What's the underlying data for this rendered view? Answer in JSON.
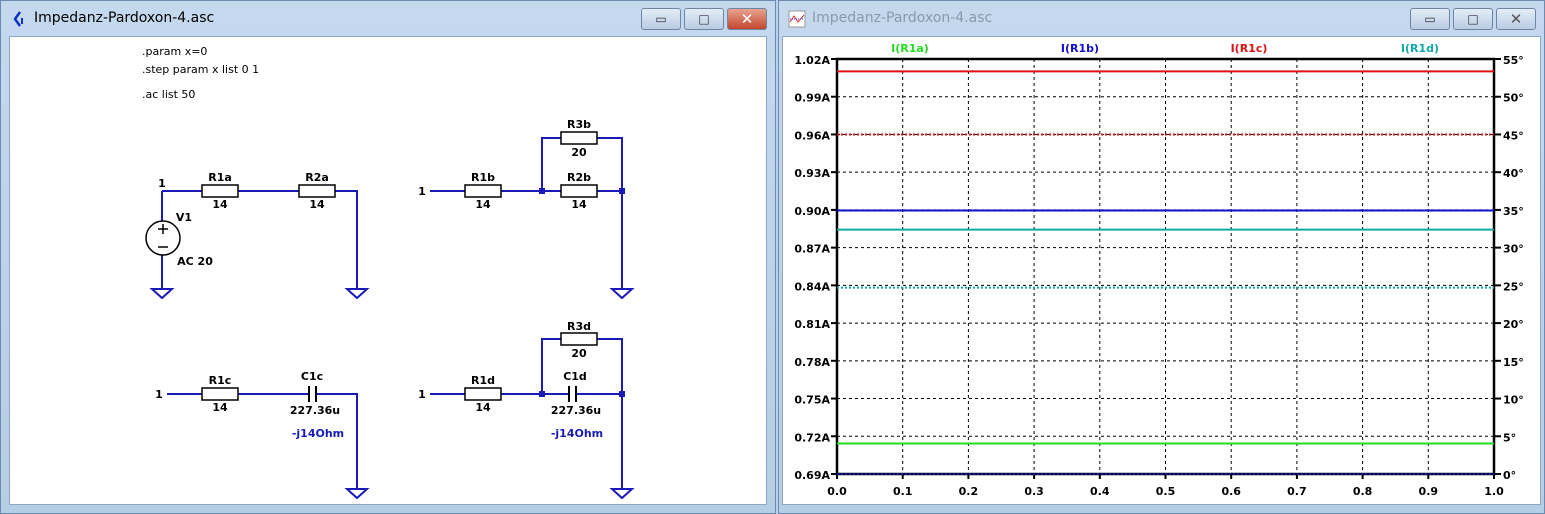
{
  "schematic_window": {
    "title": "Impedanz-Pardoxon-4.asc",
    "directives": [
      ".param x=0",
      ".step param x list 0 1",
      ".ac list 50"
    ],
    "circuit_a": {
      "node": "1",
      "r1": "R1a",
      "r1_val": "14",
      "r2": "R2a",
      "r2_val": "14",
      "source": "V1",
      "source_val": "AC 20"
    },
    "circuit_b": {
      "node": "1",
      "r1": "R1b",
      "r1_val": "14",
      "r3": "R3b",
      "r3_val": "20",
      "r2": "R2b",
      "r2_val": "14"
    },
    "circuit_c": {
      "node": "1",
      "r1": "R1c",
      "r1_val": "14",
      "c": "C1c",
      "c_val": "227.36u",
      "note": "-j14Ohm"
    },
    "circuit_d": {
      "node": "1",
      "r1": "R1d",
      "r1_val": "14",
      "r3": "R3d",
      "r3_val": "20",
      "c": "C1d",
      "c_val": "227.36u",
      "note": "-j14Ohm"
    }
  },
  "plot_window": {
    "title": "Impedanz-Pardoxon-4.asc"
  },
  "window_buttons": {
    "minimize": "▭",
    "maximize": "□",
    "close": "✕"
  },
  "chart_data": {
    "type": "line",
    "xlabel": "",
    "x": [
      0,
      1
    ],
    "xlim": [
      0,
      1
    ],
    "xticks": [
      "0.0",
      "0.1",
      "0.2",
      "0.3",
      "0.4",
      "0.5",
      "0.6",
      "0.7",
      "0.8",
      "0.9",
      "1.0"
    ],
    "ylim_left": [
      0.69,
      1.02
    ],
    "yticks_left": [
      "1.02A",
      "0.99A",
      "0.96A",
      "0.93A",
      "0.90A",
      "0.87A",
      "0.84A",
      "0.81A",
      "0.78A",
      "0.75A",
      "0.72A",
      "0.69A"
    ],
    "ylim_right": [
      0,
      55
    ],
    "yticks_right": [
      "55°",
      "50°",
      "45°",
      "40°",
      "35°",
      "30°",
      "25°",
      "20°",
      "15°",
      "10°",
      "5°",
      "0°"
    ],
    "grid": true,
    "series": [
      {
        "name": "I(R1a)",
        "color": "#22dd22",
        "magnitude": 0.7143,
        "phase": 0
      },
      {
        "name": "I(R1b)",
        "color": "#1010cc",
        "magnitude": 0.8995,
        "phase": 0
      },
      {
        "name": "I(R1c)",
        "color": "#dd1111",
        "magnitude": 1.0102,
        "phase": 45
      },
      {
        "name": "I(R1d)",
        "color": "#10a8a8",
        "magnitude": 0.8843,
        "phase": 24.7
      }
    ]
  }
}
